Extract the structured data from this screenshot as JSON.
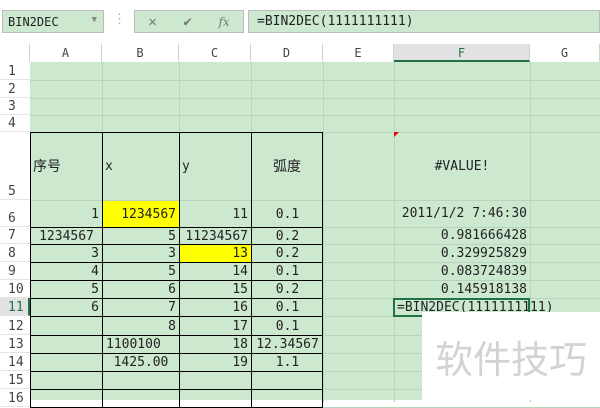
{
  "name_box": "BIN2DEC",
  "formula_bar": {
    "cancel": "✕",
    "confirm": "✔",
    "fx": "fx",
    "value": "=BIN2DEC(1111111111)"
  },
  "columns": [
    "A",
    "B",
    "C",
    "D",
    "E",
    "F",
    "G"
  ],
  "rows": [
    "1",
    "2",
    "3",
    "4",
    "5",
    "6",
    "7",
    "8",
    "9",
    "10",
    "11",
    "12",
    "13",
    "14",
    "15",
    "16"
  ],
  "table": {
    "headers": [
      "序号",
      "x",
      "y",
      "弧度"
    ],
    "rows": [
      [
        "1",
        "1234567",
        "11",
        "0.1"
      ],
      [
        "1234567",
        "5",
        "11234567",
        "0.2"
      ],
      [
        "3",
        "3",
        "13",
        "0.2"
      ],
      [
        "4",
        "5",
        "14",
        "0.1"
      ],
      [
        "5",
        "6",
        "15",
        "0.2"
      ],
      [
        "6",
        "7",
        "16",
        "0.1"
      ],
      [
        "",
        "8",
        "17",
        "0.1"
      ],
      [
        "",
        "1100100",
        "18",
        "12.34567"
      ],
      [
        "",
        "1425.00",
        "19",
        "1.1"
      ]
    ]
  },
  "f_column": [
    "#VALUE!",
    "2011/1/2 7:46:30",
    "0.981666428",
    "0.329925829",
    "0.083724839",
    "0.145918138",
    "=BIN2DEC(1111111111)"
  ],
  "watermark": "软件技巧",
  "colors": {
    "sheet": "#cce8cf",
    "accent": "#217346",
    "highlight": "#ffff00"
  }
}
